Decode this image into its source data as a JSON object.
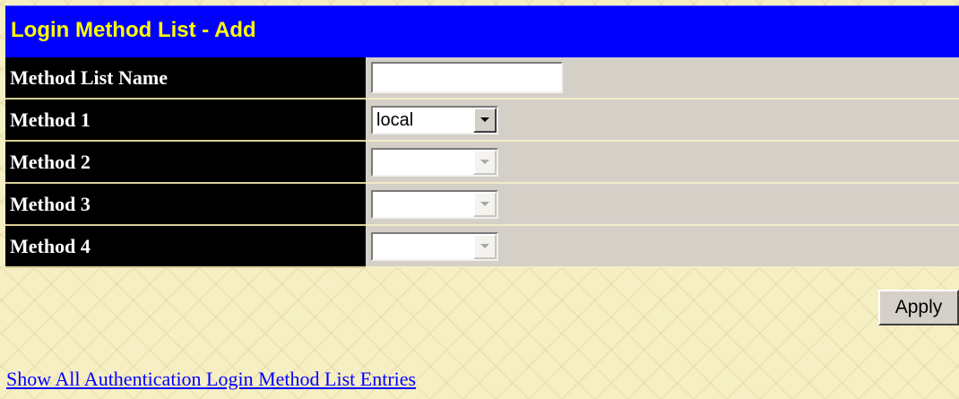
{
  "form": {
    "title": "Login Method List - Add",
    "rows": [
      {
        "label": "Method List Name",
        "type": "text",
        "value": "",
        "placeholder": ""
      },
      {
        "label": "Method 1",
        "type": "select",
        "value": "local",
        "enabled": true
      },
      {
        "label": "Method 2",
        "type": "select",
        "value": "",
        "enabled": false
      },
      {
        "label": "Method 3",
        "type": "select",
        "value": "",
        "enabled": false
      },
      {
        "label": "Method 4",
        "type": "select",
        "value": "",
        "enabled": false
      }
    ],
    "apply_label": "Apply"
  },
  "links": {
    "show_all": "Show All Authentication Login Method List Entries"
  },
  "colors": {
    "title_bg": "#0000ff",
    "title_text": "#ffff00",
    "label_bg": "#000000",
    "label_text": "#ffffff",
    "value_bg": "#d4d0c8",
    "page_bg": "#f6efc4",
    "link": "#0000ff"
  },
  "icons": {
    "dropdown": "chevron-down-icon"
  }
}
